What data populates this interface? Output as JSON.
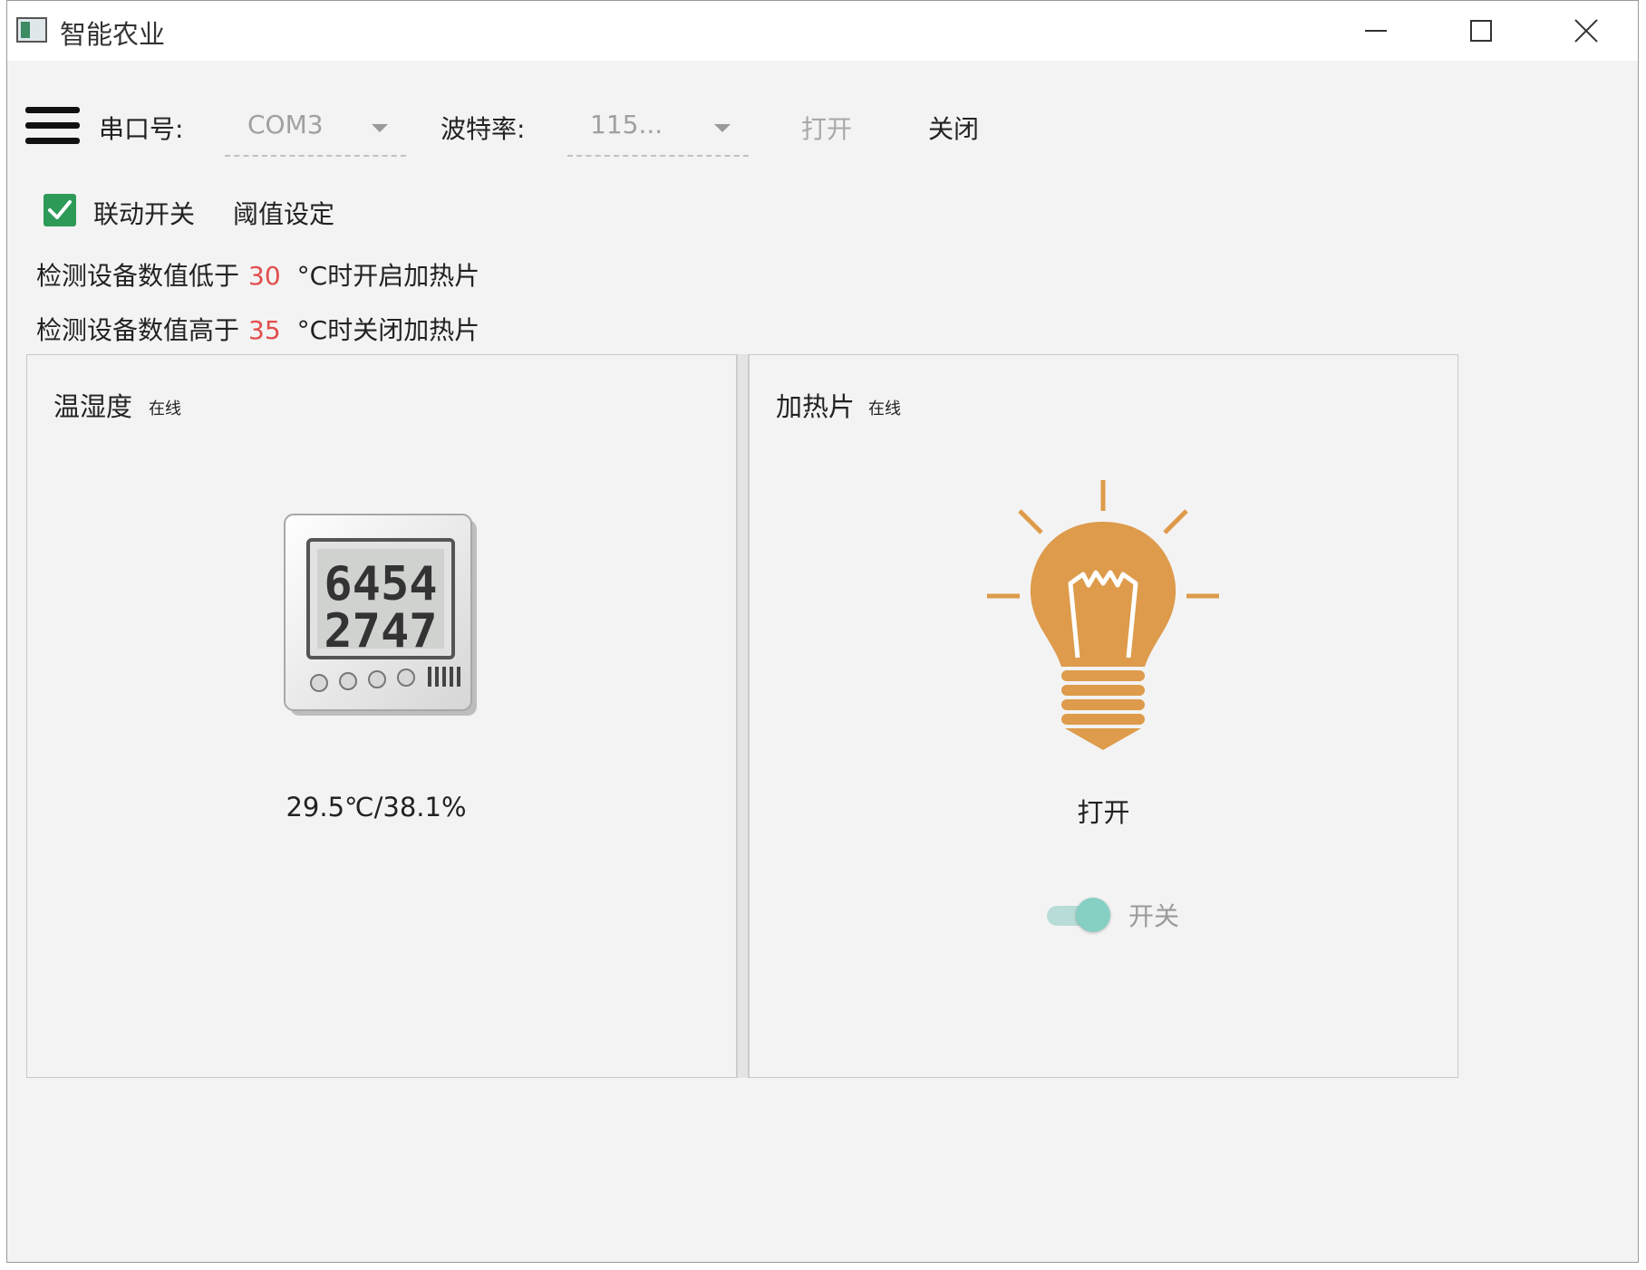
{
  "window": {
    "title": "智能农业"
  },
  "toolbar": {
    "port_label": "串口号:",
    "port_value": "COM3",
    "baud_label": "波特率:",
    "baud_value": "115...",
    "open_label": "打开",
    "close_label": "关闭"
  },
  "linkage": {
    "checked": true,
    "label": "联动开关",
    "threshold_label": "阈值设定"
  },
  "rules": {
    "low_prefix": "检测设备数值低于",
    "low_value": "30",
    "low_suffix": "°C时开启加热片",
    "high_prefix": "检测设备数值高于",
    "high_value": "35",
    "high_suffix": "°C时关闭加热片"
  },
  "panels": {
    "sensor": {
      "title": "温湿度",
      "status": "在线",
      "value": "29.5℃/38.1%",
      "icon": "thermo-hygrometer-icon"
    },
    "heater": {
      "title": "加热片",
      "status": "在线",
      "value": "打开",
      "icon": "light-bulb-icon",
      "toggle_on": true,
      "toggle_label": "开关"
    }
  },
  "colors": {
    "accent_green": "#2e9a58",
    "threshold_red": "#e24d4d",
    "bulb_orange": "#dd9b4b",
    "toggle_teal": "#86cfc3"
  }
}
